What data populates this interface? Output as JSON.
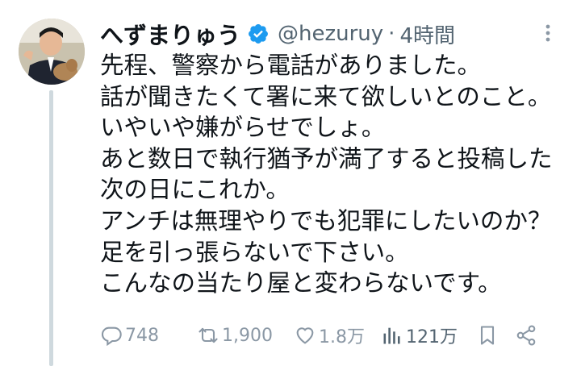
{
  "tweet": {
    "author_name": "へずまりゅう",
    "handle": "@hezuruy",
    "separator": "·",
    "time": "4時間",
    "lines": [
      "先程、警察から電話がありました。",
      "話が聞きたくて署に来て欲しいとのこと。",
      "いやいや嫌がらせでしょ。",
      "あと数日で執行猶予が満了すると投稿した",
      "次の日にこれか。",
      "アンチは無理やりでも犯罪にしたいのか？",
      "足を引っ張らないで下さい。",
      "こんなの当たり屋と変わらないです。"
    ]
  },
  "actions": {
    "replies": "748",
    "retweets": "1,900",
    "likes": "1.8万",
    "views": "121万"
  },
  "colors": {
    "text": "#0f1419",
    "secondary": "#536471",
    "verified": "#1d9bf0",
    "thread_line": "#cfd9de"
  },
  "icons": [
    "verified-badge-icon",
    "more-icon",
    "reply-icon",
    "retweet-icon",
    "like-icon",
    "views-icon",
    "bookmark-icon",
    "share-icon"
  ]
}
